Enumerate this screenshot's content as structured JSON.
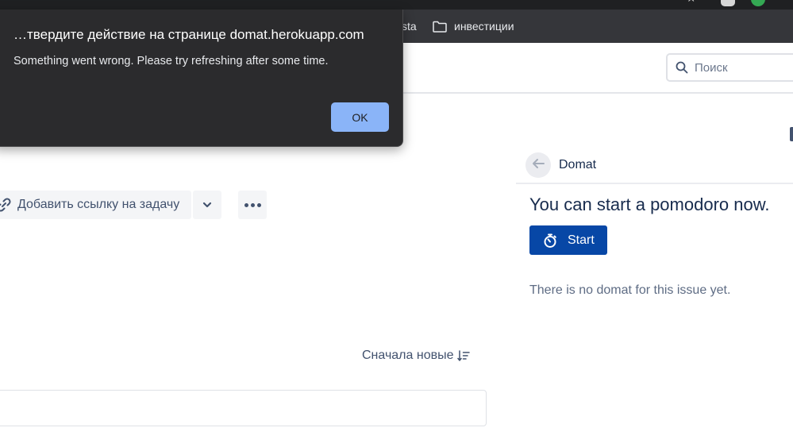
{
  "browser": {
    "bookmarks": [
      {
        "label": "sta"
      },
      {
        "label": "инвестиции",
        "icon": "folder-icon"
      }
    ]
  },
  "header": {
    "search": {
      "placeholder": "Поиск",
      "icon": "search-icon"
    }
  },
  "issue": {
    "actions": {
      "add_link_label": "Добавить ссылку на задачу",
      "link_icon": "link-icon",
      "dropdown_icon": "chevron-down-icon",
      "more_icon": "more-icon"
    },
    "activity": {
      "sort_label": "Сначала новые",
      "sort_icon": "sort-icon"
    }
  },
  "panel": {
    "title": "Domat",
    "back_icon": "arrow-left-icon",
    "heading": "You can start a pomodoro now.",
    "start_label": "Start",
    "start_icon": "stopwatch-icon",
    "note": "There is no domat for this issue yet."
  },
  "dialog": {
    "title": "…твердите действие на странице domat.herokuapp.com",
    "message": "Something went wrong. Please try refreshing after some time.",
    "ok_label": "OK"
  },
  "colors": {
    "dialog_bg": "#2b2b2d",
    "ok_button": "#8ab4f8",
    "primary_button": "#0747a6",
    "bookmarks_bar": "#35363a"
  }
}
